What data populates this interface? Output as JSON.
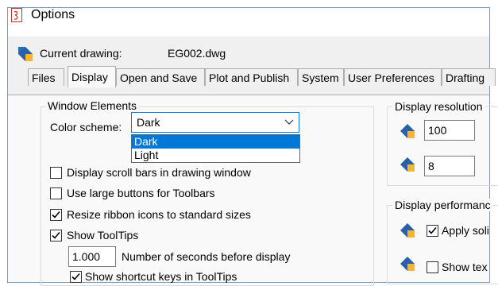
{
  "window": {
    "title": "Options"
  },
  "drawing": {
    "label": "Current drawing:",
    "filename": "EG002.dwg"
  },
  "tabs": [
    {
      "label": "Files"
    },
    {
      "label": "Display"
    },
    {
      "label": "Open and Save"
    },
    {
      "label": "Plot and Publish"
    },
    {
      "label": "System"
    },
    {
      "label": "User Preferences"
    },
    {
      "label": "Drafting"
    }
  ],
  "active_tab": "Display",
  "window_elements": {
    "title": "Window Elements",
    "color_scheme_label": "Color scheme:",
    "color_scheme_value": "Dark",
    "color_scheme_options": [
      "Dark",
      "Light"
    ],
    "scrollbars_label": "Display scroll bars in drawing window",
    "scrollbars_checked": false,
    "large_buttons_label": "Use large buttons for Toolbars",
    "large_buttons_checked": false,
    "resize_ribbon_label": "Resize ribbon icons to standard sizes",
    "resize_ribbon_checked": true,
    "tooltips_label": "Show ToolTips",
    "tooltips_checked": true,
    "seconds_value": "1.000",
    "seconds_label": "Number of seconds before display",
    "shortcut_keys_label": "Show shortcut keys in ToolTips",
    "shortcut_keys_checked": true
  },
  "display_resolution": {
    "title": "Display resolution",
    "value1": "100",
    "value2": "8"
  },
  "display_performance": {
    "title": "Display performanc",
    "apply_label": "Apply soli",
    "apply_checked": true,
    "show_text_label": "Show tex",
    "show_text_checked": false
  },
  "colors": {
    "accent": "#0078d7",
    "panel": "#f9f9f9",
    "tabbar": "#f0f0f0"
  }
}
